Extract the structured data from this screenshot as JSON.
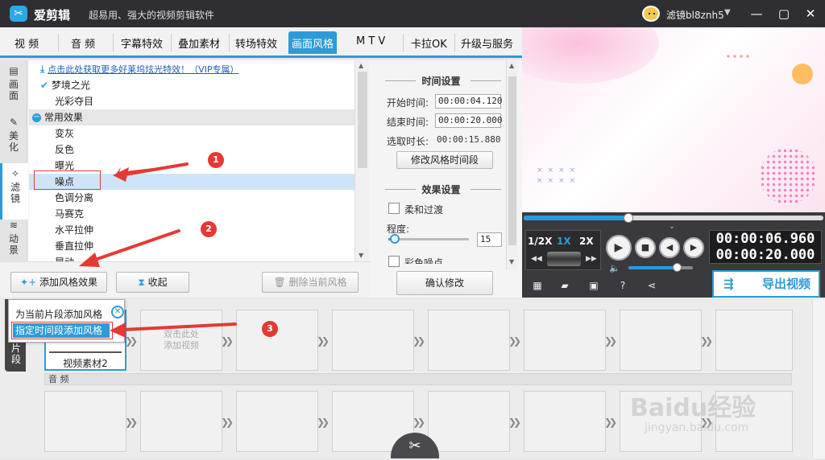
{
  "app": {
    "name": "爱剪辑",
    "slogan": "超易用、强大的视频剪辑软件",
    "username": "滤镜bl8znh5"
  },
  "tabs": [
    {
      "label": "视 频"
    },
    {
      "label": "音 频"
    },
    {
      "label": "字幕特效"
    },
    {
      "label": "叠加素材"
    },
    {
      "label": "转场特效"
    },
    {
      "label": "画面风格",
      "active": true
    },
    {
      "label": "M T V"
    },
    {
      "label": "卡拉OK"
    },
    {
      "label": "升级与服务"
    }
  ],
  "side_tabs": [
    {
      "label": "画面",
      "icon": "film-icon"
    },
    {
      "label": "美化",
      "icon": "brush-icon"
    },
    {
      "label": "滤镜",
      "icon": "wand-icon",
      "active": true
    },
    {
      "label": "动景",
      "icon": "wave-icon"
    }
  ],
  "effects": {
    "vip_link": "点击此处获取更多好莱坞炫光特效！（VIP专属）",
    "items": [
      {
        "label": "梦境之光",
        "checked": true
      },
      {
        "label": "光彩夺目"
      }
    ],
    "group": "常用效果",
    "group_items": [
      {
        "label": "变灰"
      },
      {
        "label": "反色"
      },
      {
        "label": "曝光"
      },
      {
        "label": "噪点",
        "selected": true
      },
      {
        "label": "色调分离"
      },
      {
        "label": "马赛克"
      },
      {
        "label": "水平拉伸"
      },
      {
        "label": "垂直拉伸"
      },
      {
        "label": "晃动"
      }
    ]
  },
  "buttons": {
    "add_style": "添加风格效果",
    "collapse": "收起",
    "delete_style": "删除当前风格",
    "confirm": "确认修改",
    "modify_time": "修改风格时间段"
  },
  "time_settings": {
    "title": "时间设置",
    "start_label": "开始时间:",
    "start_value": "00:00:04.120",
    "end_label": "结束时间:",
    "end_value": "00:00:20.000",
    "duration_label": "选取时长:",
    "duration_value": "00:00:15.880"
  },
  "effect_settings": {
    "title": "效果设置",
    "soft_transition": "柔和过渡",
    "degree_label": "程度:",
    "degree_value": "15",
    "degree_fraction": 0.08,
    "color_noise": "彩色噪点"
  },
  "player": {
    "speeds": [
      "1/2X",
      "1X",
      "2X"
    ],
    "active_speed": "1X",
    "current_time": "00:00:06.960",
    "total_time": "00:00:20.000",
    "progress_fraction": 0.35,
    "volume_fraction": 0.75,
    "export_label": "导出视频"
  },
  "popup_menu": {
    "item1": "为当前片段添加风格",
    "item2": "指定时间段添加风格"
  },
  "timeline": {
    "side_label": "片段",
    "clip1_label": "视频素材2",
    "add_hint_line1": "双击此处",
    "add_hint_line2": "添加视频",
    "audio_label": "音 频"
  },
  "markers": [
    "1",
    "2",
    "3"
  ],
  "watermark": {
    "brand": "Baidu经验",
    "url": "jingyan.baidu.com"
  },
  "colors": {
    "accent": "#2d9bd8",
    "titlebar": "#2f2f33",
    "selection": "#cfe4f7",
    "annotation": "#e53935"
  }
}
